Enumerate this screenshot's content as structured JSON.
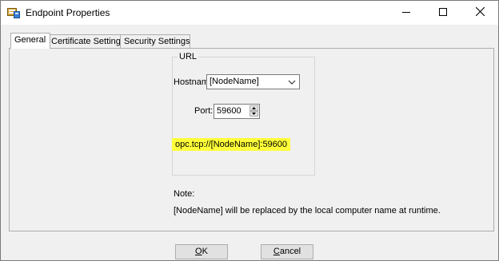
{
  "window": {
    "title": "Endpoint Properties",
    "icon": "properties-icon",
    "controls": [
      "minimize-icon",
      "maximize-icon",
      "close-icon"
    ]
  },
  "tabs": [
    {
      "label": "General",
      "active": true
    },
    {
      "label": "Certificate Settings",
      "active": false
    },
    {
      "label": "Security Settings",
      "active": false
    }
  ],
  "general": {
    "group_title": "URL",
    "hostname_label": "Hostname:",
    "hostname_value": "[NodeName]",
    "port_label": "Port:",
    "port_value": "59600",
    "url": "opc.tcp://[NodeName]:59600",
    "note_label": "Note:",
    "note_text": "[NodeName] will be replaced by the local computer name at runtime."
  },
  "buttons": {
    "ok_mnemonic": "O",
    "ok_rest": "K",
    "cancel_mnemonic": "C",
    "cancel_rest": "ancel"
  },
  "colors": {
    "highlight": "#ffff3a",
    "window_bg": "#f0f0f0"
  }
}
